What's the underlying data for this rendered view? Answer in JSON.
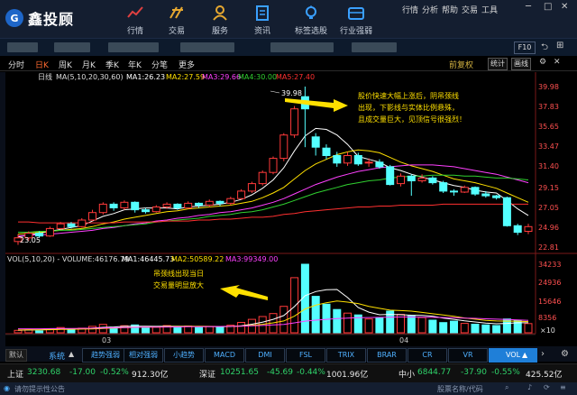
{
  "app": {
    "name": "鑫投顾"
  },
  "nav": [
    {
      "label": "行情",
      "icon": "trend-chart-icon"
    },
    {
      "label": "交易",
      "icon": "trade-icon"
    },
    {
      "label": "服务",
      "icon": "user-service-icon"
    },
    {
      "label": "资讯",
      "icon": "news-icon"
    },
    {
      "label": "标签选股",
      "icon": "lightbulb-icon"
    },
    {
      "label": "行业强弱",
      "icon": "industry-icon"
    }
  ],
  "menu": [
    "行情",
    "分析",
    "帮助",
    "交易",
    "工具"
  ],
  "window": {
    "min": "─",
    "max": "□",
    "close": "✕"
  },
  "toolbar2": {
    "f10": "F10"
  },
  "periods": [
    "分时",
    "日K",
    "周K",
    "月K",
    "季K",
    "年K",
    "分笔",
    "更多"
  ],
  "active_period": "日K",
  "adjust": "前复权",
  "tools": [
    "统计",
    "画线"
  ],
  "ma_legend": {
    "label": "日线",
    "title": "MA(5,10,20,30,60)",
    "ma1": "MA1:26.23",
    "ma2": "MA2:27.59",
    "ma3": "MA3:29.66",
    "ma4": "MA4:30.00",
    "ma5": "MA5:27.40"
  },
  "vol_legend": {
    "title": "VOL(5,10,20) - VOLUME:46176.79",
    "ma1": "MA1:46445.73",
    "ma2": "MA2:50589.22",
    "ma3": "MA3:99349.00"
  },
  "annotations": {
    "top": [
      "股价快速大幅上涨后，阴吊颈线",
      "出现，下影线与实体比例悬殊，",
      "且成交量巨大，见顶信号很强烈！"
    ],
    "vol": [
      "吊颈线出现当日",
      "交易量明显放大"
    ]
  },
  "price_labels": {
    "high": "39.98",
    "low": "23.05"
  },
  "y_axis_price": [
    "39.98",
    "37.83",
    "35.65",
    "33.47",
    "31.40",
    "29.15",
    "27.05",
    "24.96",
    "22.81"
  ],
  "y_axis_vol": [
    "34233",
    "24936",
    "15646",
    "8356",
    "×10"
  ],
  "x_axis": [
    "03",
    "04"
  ],
  "chart_data": [
    {
      "type": "candlestick",
      "title": "日线 MA(5,10,20,30,60)",
      "ylim": [
        22.81,
        39.98
      ],
      "candles": [
        {
          "o": 23.4,
          "c": 23.8,
          "h": 24.2,
          "l": 23.05
        },
        {
          "o": 23.8,
          "c": 24.3,
          "h": 24.5,
          "l": 23.5
        },
        {
          "o": 24.3,
          "c": 24.0,
          "h": 24.5,
          "l": 23.8
        },
        {
          "o": 24.0,
          "c": 24.8,
          "h": 25.0,
          "l": 23.9
        },
        {
          "o": 24.8,
          "c": 25.3,
          "h": 25.5,
          "l": 24.7
        },
        {
          "o": 25.3,
          "c": 25.0,
          "h": 25.5,
          "l": 24.8
        },
        {
          "o": 25.0,
          "c": 25.7,
          "h": 25.9,
          "l": 24.9
        },
        {
          "o": 25.7,
          "c": 26.5,
          "h": 26.8,
          "l": 25.6
        },
        {
          "o": 26.5,
          "c": 27.4,
          "h": 27.6,
          "l": 26.3
        },
        {
          "o": 27.4,
          "c": 27.0,
          "h": 27.6,
          "l": 26.7
        },
        {
          "o": 27.0,
          "c": 27.6,
          "h": 27.8,
          "l": 26.8
        },
        {
          "o": 27.6,
          "c": 26.8,
          "h": 27.7,
          "l": 26.5
        },
        {
          "o": 26.8,
          "c": 26.6,
          "h": 27.0,
          "l": 26.4
        },
        {
          "o": 26.6,
          "c": 27.1,
          "h": 27.3,
          "l": 26.5
        },
        {
          "o": 27.1,
          "c": 27.4,
          "h": 27.6,
          "l": 26.9
        },
        {
          "o": 27.4,
          "c": 27.0,
          "h": 27.5,
          "l": 26.8
        },
        {
          "o": 27.0,
          "c": 27.5,
          "h": 27.7,
          "l": 26.9
        },
        {
          "o": 27.5,
          "c": 27.3,
          "h": 27.6,
          "l": 27.0
        },
        {
          "o": 27.3,
          "c": 27.7,
          "h": 27.9,
          "l": 27.1
        },
        {
          "o": 27.7,
          "c": 27.5,
          "h": 27.8,
          "l": 27.2
        },
        {
          "o": 27.5,
          "c": 28.0,
          "h": 28.2,
          "l": 27.3
        },
        {
          "o": 28.0,
          "c": 28.8,
          "h": 29.0,
          "l": 27.9
        },
        {
          "o": 28.8,
          "c": 29.6,
          "h": 29.8,
          "l": 28.6
        },
        {
          "o": 29.6,
          "c": 30.8,
          "h": 31.0,
          "l": 29.4
        },
        {
          "o": 30.8,
          "c": 32.3,
          "h": 32.5,
          "l": 30.6
        },
        {
          "o": 32.3,
          "c": 34.8,
          "h": 35.0,
          "l": 32.0
        },
        {
          "o": 34.8,
          "c": 37.6,
          "h": 37.9,
          "l": 34.5
        },
        {
          "o": 38.9,
          "c": 37.6,
          "h": 39.98,
          "l": 33.5
        },
        {
          "o": 34.6,
          "c": 33.5,
          "h": 35.0,
          "l": 32.6
        },
        {
          "o": 33.4,
          "c": 32.6,
          "h": 33.8,
          "l": 32.2
        },
        {
          "o": 32.6,
          "c": 31.8,
          "h": 33.0,
          "l": 31.4
        },
        {
          "o": 31.8,
          "c": 32.6,
          "h": 33.0,
          "l": 31.5
        },
        {
          "o": 32.6,
          "c": 31.7,
          "h": 32.9,
          "l": 31.5
        },
        {
          "o": 31.8,
          "c": 31.9,
          "h": 32.3,
          "l": 31.4
        },
        {
          "o": 31.9,
          "c": 31.4,
          "h": 32.2,
          "l": 31.2
        },
        {
          "o": 31.4,
          "c": 29.5,
          "h": 31.6,
          "l": 29.4
        },
        {
          "o": 29.6,
          "c": 30.4,
          "h": 30.7,
          "l": 29.3
        },
        {
          "o": 30.4,
          "c": 29.9,
          "h": 30.6,
          "l": 28.3
        },
        {
          "o": 29.9,
          "c": 30.2,
          "h": 30.6,
          "l": 29.7
        },
        {
          "o": 30.2,
          "c": 29.7,
          "h": 30.4,
          "l": 29.5
        },
        {
          "o": 29.7,
          "c": 28.8,
          "h": 29.9,
          "l": 28.6
        },
        {
          "o": 28.8,
          "c": 28.7,
          "h": 29.0,
          "l": 28.3
        },
        {
          "o": 28.7,
          "c": 29.2,
          "h": 29.4,
          "l": 28.6
        },
        {
          "o": 29.2,
          "c": 28.5,
          "h": 29.3,
          "l": 28.3
        },
        {
          "o": 28.5,
          "c": 28.3,
          "h": 28.8,
          "l": 28.1
        },
        {
          "o": 28.3,
          "c": 28.1,
          "h": 28.4,
          "l": 27.9
        },
        {
          "o": 28.1,
          "c": 25.1,
          "h": 28.2,
          "l": 25.0
        },
        {
          "o": 25.1,
          "c": 24.4,
          "h": 25.3,
          "l": 24.1
        },
        {
          "o": 24.5,
          "c": 25.0,
          "h": 25.3,
          "l": 24.2
        }
      ],
      "ma_lines": [
        {
          "name": "MA1",
          "color": "#ffffff",
          "values": [
            23.9,
            24.1,
            24.3,
            24.5,
            24.7,
            24.9,
            25.1,
            25.6,
            26.1,
            26.4,
            26.8,
            26.9,
            27.0,
            27.0,
            27.0,
            26.9,
            27.1,
            27.2,
            27.3,
            27.4,
            27.6,
            27.9,
            28.4,
            29.1,
            30.0,
            31.3,
            33.1,
            34.7,
            35.5,
            35.4,
            34.8,
            33.8,
            32.5,
            32.2,
            31.9,
            31.3,
            31.0,
            30.6,
            30.3,
            30.0,
            29.7,
            29.4,
            29.2,
            28.9,
            28.7,
            28.6,
            27.8,
            26.9,
            26.2
          ]
        },
        {
          "name": "MA2",
          "color": "#ffe000",
          "values": [
            24.2,
            24.3,
            24.4,
            24.5,
            24.6,
            24.7,
            24.8,
            25.0,
            25.3,
            25.5,
            25.8,
            26.0,
            26.2,
            26.4,
            26.6,
            26.7,
            26.9,
            27.0,
            27.1,
            27.2,
            27.3,
            27.5,
            27.7,
            28.1,
            28.6,
            29.2,
            30.1,
            31.0,
            31.7,
            32.2,
            32.7,
            33.0,
            33.2,
            33.1,
            32.9,
            32.4,
            31.9,
            31.5,
            31.2,
            30.9,
            30.5,
            30.1,
            29.9,
            29.7,
            29.4,
            29.1,
            28.6,
            28.1,
            27.6
          ]
        },
        {
          "name": "MA3",
          "color": "#ff40ff",
          "values": [
            24.0,
            24.1,
            24.1,
            24.2,
            24.3,
            24.4,
            24.5,
            24.6,
            24.8,
            24.9,
            25.1,
            25.3,
            25.4,
            25.6,
            25.7,
            25.9,
            26.0,
            26.2,
            26.3,
            26.5,
            26.6,
            26.8,
            27.0,
            27.3,
            27.6,
            28.0,
            28.5,
            29.0,
            29.5,
            29.9,
            30.3,
            30.6,
            30.9,
            31.1,
            31.3,
            31.4,
            31.5,
            31.6,
            31.6,
            31.6,
            31.5,
            31.4,
            31.2,
            31.0,
            30.8,
            30.6,
            30.3,
            30.0,
            29.7
          ]
        },
        {
          "name": "MA4",
          "color": "#30d030",
          "values": [
            24.4,
            24.4,
            24.5,
            24.5,
            24.6,
            24.6,
            24.7,
            24.8,
            24.9,
            25.0,
            25.1,
            25.2,
            25.3,
            25.5,
            25.6,
            25.7,
            25.8,
            25.9,
            26.1,
            26.2,
            26.3,
            26.5,
            26.6,
            26.8,
            27.1,
            27.4,
            27.8,
            28.2,
            28.6,
            28.9,
            29.2,
            29.5,
            29.7,
            29.9,
            30.0,
            30.2,
            30.3,
            30.4,
            30.4,
            30.5,
            30.5,
            30.5,
            30.4,
            30.4,
            30.3,
            30.2,
            30.2,
            30.1,
            30.0
          ]
        },
        {
          "name": "MA5",
          "color": "#ff3030",
          "values": [
            25.5,
            25.5,
            25.4,
            25.4,
            25.4,
            25.4,
            25.4,
            25.4,
            25.4,
            25.4,
            25.5,
            25.5,
            25.5,
            25.5,
            25.6,
            25.6,
            25.6,
            25.7,
            25.7,
            25.8,
            25.8,
            25.9,
            26.0,
            26.0,
            26.1,
            26.3,
            26.4,
            26.6,
            26.7,
            26.8,
            26.9,
            27.0,
            27.1,
            27.1,
            27.2,
            27.2,
            27.3,
            27.3,
            27.3,
            27.3,
            27.4,
            27.4,
            27.4,
            27.4,
            27.4,
            27.4,
            27.4,
            27.4,
            27.4
          ]
        }
      ]
    },
    {
      "type": "bar",
      "title": "VOL(5,10,20)",
      "ylim": [
        0,
        34233
      ],
      "values": [
        1200,
        1500,
        900,
        1800,
        2600,
        1700,
        2300,
        3200,
        4200,
        2800,
        3500,
        3900,
        2400,
        2800,
        3600,
        3000,
        3400,
        2600,
        3100,
        2700,
        3800,
        5200,
        6700,
        8100,
        9600,
        13200,
        27500,
        34233,
        18200,
        14300,
        11600,
        9800,
        8900,
        6900,
        7600,
        10800,
        9200,
        8400,
        7600,
        6300,
        5100,
        5800,
        4700,
        4300,
        3900,
        3600,
        6900,
        6100,
        4600
      ],
      "ma_lines": [
        {
          "name": "MA1",
          "color": "#ffffff",
          "values": [
            1300,
            1400,
            1500,
            1600,
            1800,
            1900,
            2000,
            2300,
            2700,
            2900,
            3200,
            3300,
            3300,
            3200,
            3300,
            3300,
            3300,
            3100,
            3100,
            3000,
            3100,
            3500,
            4300,
            5300,
            6700,
            8600,
            13100,
            18500,
            20600,
            21500,
            21600,
            17600,
            12600,
            10300,
            9000,
            9200,
            9000,
            8800,
            8700,
            8300,
            7300,
            6700,
            6000,
            5400,
            4800,
            4500,
            4700,
            5000,
            5000
          ]
        },
        {
          "name": "MA2",
          "color": "#ffe000",
          "values": [
            1400,
            1450,
            1500,
            1550,
            1650,
            1750,
            1850,
            1950,
            2150,
            2350,
            2500,
            2650,
            2800,
            2900,
            3000,
            3100,
            3200,
            3250,
            3200,
            3150,
            3200,
            3350,
            3800,
            4250,
            4950,
            5900,
            8300,
            11900,
            13800,
            15000,
            15900,
            15300,
            14600,
            13200,
            12200,
            11300,
            11100,
            10800,
            10200,
            9500,
            8900,
            8200,
            7400,
            6800,
            6200,
            5900,
            5800,
            5800,
            5600
          ]
        },
        {
          "name": "MA3",
          "color": "#ff40ff",
          "values": [
            2000,
            2000,
            2000,
            2050,
            2100,
            2150,
            2200,
            2300,
            2400,
            2500,
            2600,
            2700,
            2800,
            2850,
            2900,
            2950,
            3000,
            3050,
            3100,
            3150,
            3200,
            3300,
            3450,
            3650,
            3900,
            4200,
            4950,
            5800,
            6300,
            6700,
            7100,
            7300,
            7500,
            7600,
            7700,
            7800,
            7900,
            7900,
            7800,
            7700,
            7600,
            7500,
            7300,
            7200,
            7000,
            6800,
            6600,
            6400,
            6200
          ]
        }
      ]
    }
  ],
  "indicators": [
    "趋势强弱",
    "相对强弱",
    "小趋势",
    "MACD",
    "DMI",
    "FSL",
    "TRIX",
    "BRAR",
    "CR",
    "VR",
    "VOL"
  ],
  "active_indicator": "VOL",
  "ind_left": {
    "default": "默认",
    "system": "系统"
  },
  "status": {
    "sh_label": "上证",
    "sh_value": "3230.68",
    "sh_change": "-17.00",
    "sh_pct": "-0.52%",
    "sh_amount": "912.30亿",
    "sz_label": "深证",
    "sz_value": "10251.65",
    "sz_change": "-45.69",
    "sz_pct": "-0.44%",
    "sz_amount": "1001.96亿",
    "zx_label": "中小",
    "zx_value": "6844.77",
    "zx_change": "-37.90",
    "zx_pct": "-0.55%",
    "zx_amount": "425.52亿"
  },
  "footer": {
    "notice": "请勿提示性公告",
    "search_placeholder": "股票名称/代码"
  }
}
